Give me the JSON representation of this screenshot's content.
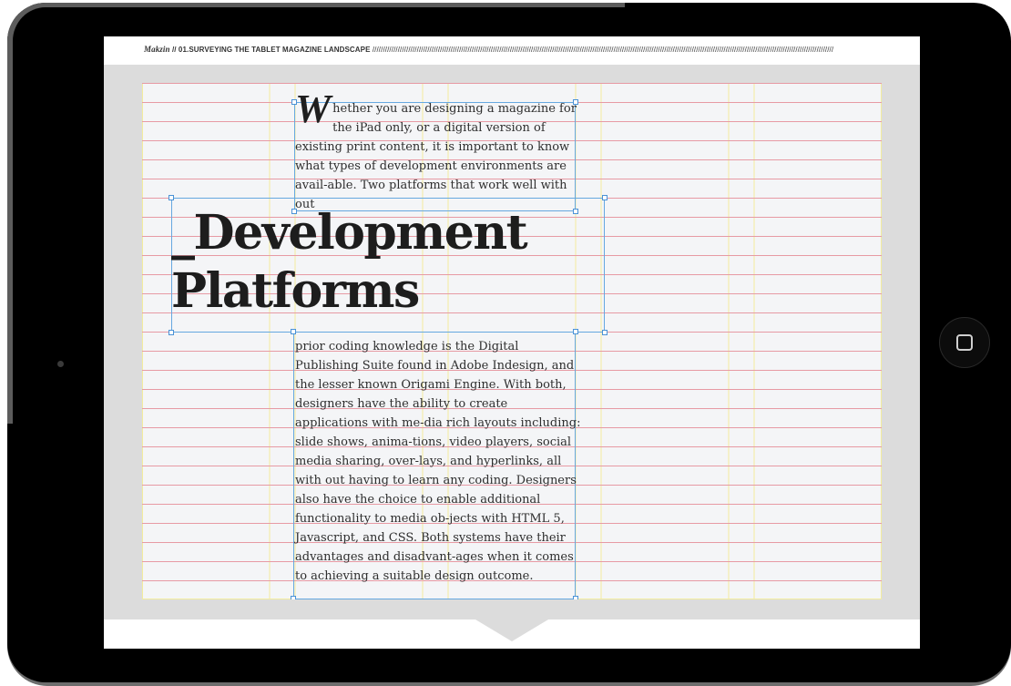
{
  "header": {
    "brand": "Makzin",
    "separator": " // ",
    "section": "01.SURVEYING THE TABLET MAGAZINE LANDSCAPE",
    "rule": "//////////////////////////////////////////////////////////////////////////////////////////////////////////////////////////////////////////////////////////////////////////////////////////////////////////////////////////"
  },
  "article": {
    "dropcap": "W",
    "lede": "hether you are designing a magazine for the iPad only, or a digital version of existing print content, it is important to know what types of development environments are avail-able. Two platforms that work well with out",
    "title_line1": "_Development",
    "title_line2": "Platforms",
    "body": "prior coding knowledge is the Digital Publishing Suite found in Adobe Indesign, and the lesser known Origami Engine.  With both, designers have the ability to create applications with me-dia rich layouts including: slide shows, anima-tions, video players, social media sharing, over-lays, and hyperlinks, all with out having to learn any coding. Designers also have the choice to enable additional functionality to media ob-jects with HTML 5, Javascript, and CSS. Both systems have their advantages and disadvant-ages when it comes to achieving a suitable design outcome."
  },
  "colors": {
    "baseline_grid": "#e79aa4",
    "column_guides": "#f3ec9e",
    "frame_outline": "#66a8e0",
    "device": "#000000",
    "pasteboard": "#dcdcdc"
  },
  "icons": {
    "home_button": "home-square-icon",
    "camera": "camera-dot"
  }
}
